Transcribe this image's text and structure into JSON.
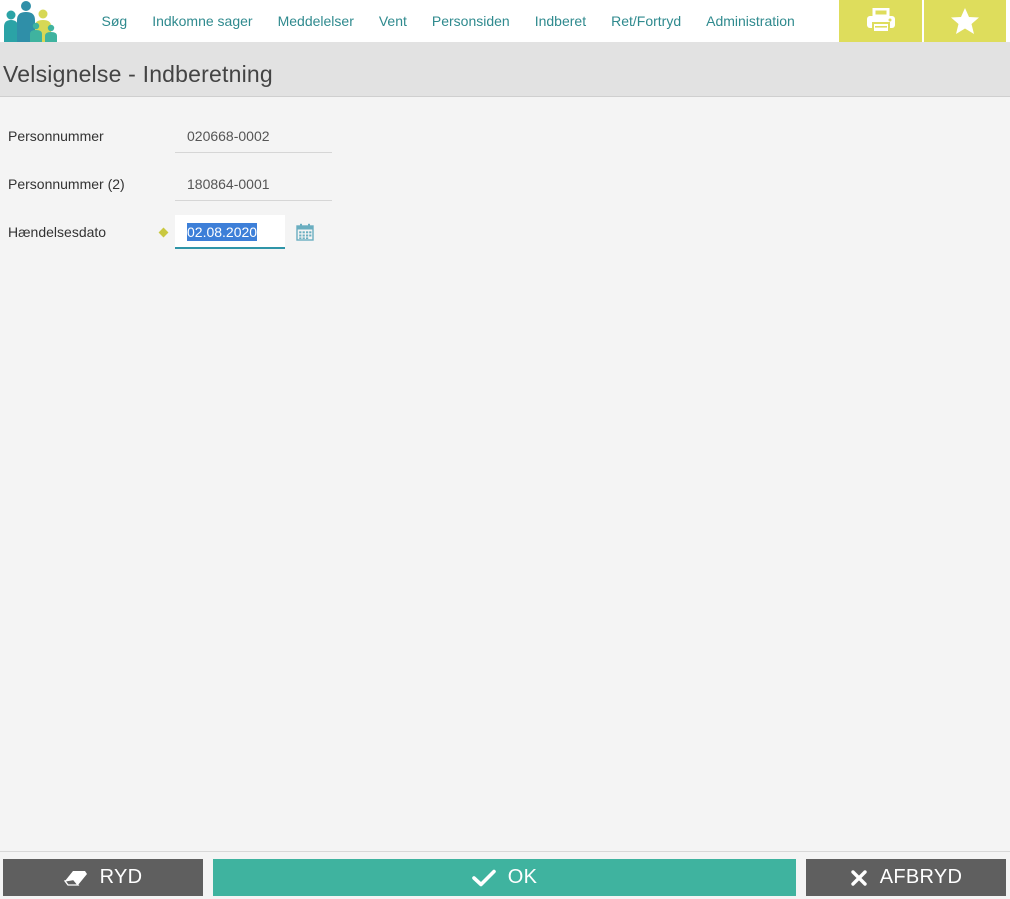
{
  "nav": {
    "items": [
      "Søg",
      "Indkomne sager",
      "Meddelelser",
      "Vent",
      "Personsiden",
      "Indberet",
      "Ret/Fortryd",
      "Administration"
    ]
  },
  "tools": {
    "print_icon": "printer-icon",
    "favorite_icon": "star-icon"
  },
  "page": {
    "title": "Velsignelse - Indberetning"
  },
  "form": {
    "person1_label": "Personnummer",
    "person1_value": "020668-0002",
    "person2_label": "Personnummer (2)",
    "person2_value": "180864-0001",
    "date_label": "Hændelsesdato",
    "date_value": "02.08.2020"
  },
  "actions": {
    "clear_label": "RYD",
    "ok_label": "OK",
    "cancel_label": "AFBRYD"
  },
  "colors": {
    "accent_teal": "#3fb39f",
    "nav_text": "#2f8a8e",
    "tool_yellow": "#dedd5c",
    "dark_button": "#5f5f5f"
  }
}
